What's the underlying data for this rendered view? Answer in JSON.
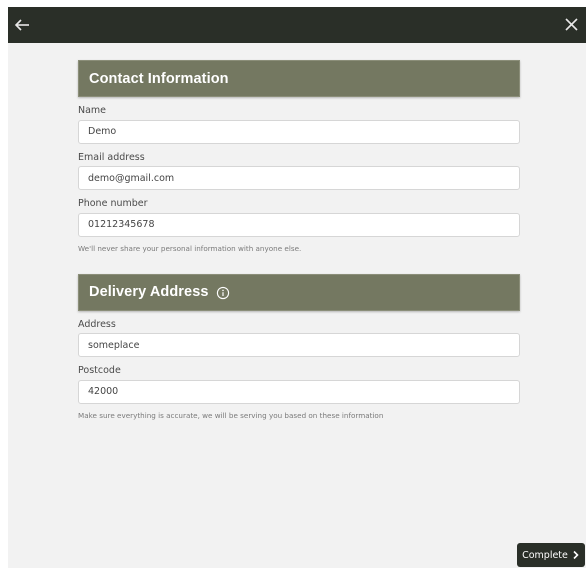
{
  "contact": {
    "title": "Contact Information",
    "name_label": "Name",
    "name_value": "Demo",
    "email_label": "Email address",
    "email_value": "demo@gmail.com",
    "phone_label": "Phone number",
    "phone_value": "01212345678",
    "help": "We'll never share your personal information with anyone else."
  },
  "delivery": {
    "title": "Delivery Address",
    "address_label": "Address",
    "address_value": "someplace",
    "postcode_label": "Postcode",
    "postcode_value": "42000",
    "help": "Make sure everything is accurate, we will be serving you based on these information"
  },
  "footer": {
    "complete_label": "Complete"
  },
  "colors": {
    "topbar": "#2a2f28",
    "section_header": "#747861",
    "background": "#f2f2f2"
  },
  "icons": {
    "back": "arrow-left-icon",
    "close": "close-icon",
    "info": "info-circle-icon",
    "chevron": "chevron-right-icon"
  }
}
